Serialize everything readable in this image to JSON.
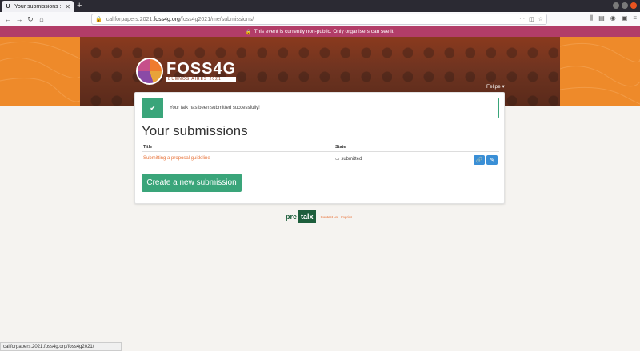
{
  "browser": {
    "tab_title": "Your submissions :: FOSS",
    "favicon": "U",
    "url_prefix": "callforpapers.2021.",
    "url_domain": "foss4g.org",
    "url_path": "/foss4g2021/me/submissions/"
  },
  "banner": {
    "text": "This event is currently non-public. Only organisers can see it."
  },
  "header": {
    "logo_name": "FOSS4G",
    "logo_sub": "BUENOS AIRES 2021",
    "user_label": "Felipe ▾"
  },
  "alert": {
    "message": "Your talk has been submitted successfully!"
  },
  "page": {
    "title": "Your submissions",
    "columns": [
      "Title",
      "State"
    ],
    "rows": [
      {
        "title": "Submitting a proposal guideline",
        "state": "submitted"
      }
    ],
    "create_label": "Create a new submission"
  },
  "footer": {
    "pre": "pre",
    "talx": "talx",
    "links": "Contact us · Imprint"
  },
  "statusbar": {
    "text": "callforpapers.2021.foss4g.org/foss4g2021/"
  },
  "colors": {
    "banner": "#b23d68",
    "header_orange": "#ee8a2a",
    "success_green": "#3aa57a",
    "link_orange": "#e8743b",
    "action_blue": "#3a8fd6"
  }
}
